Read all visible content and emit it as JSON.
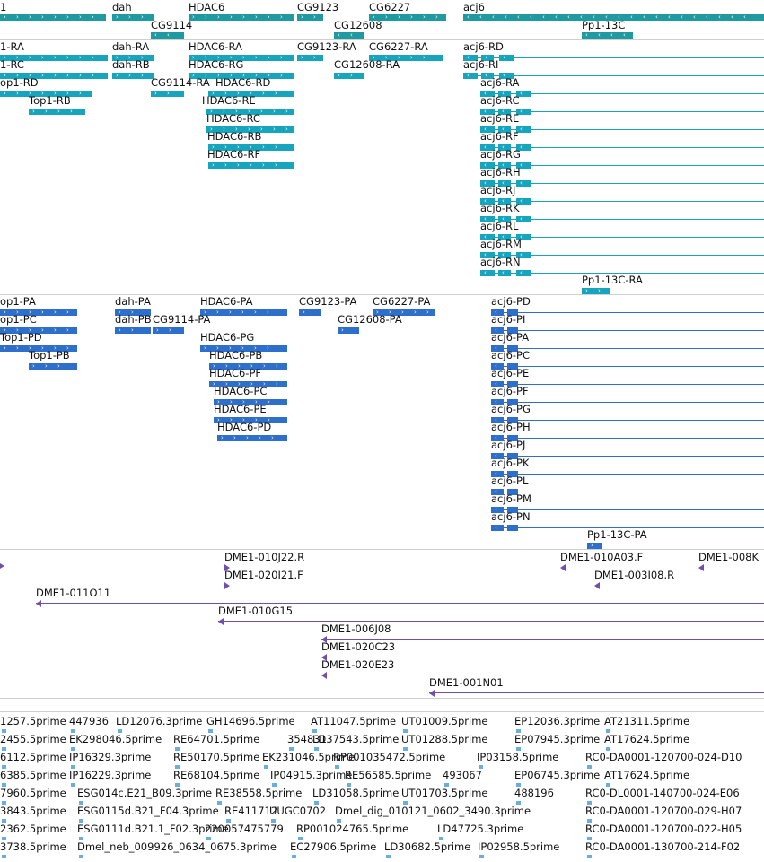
{
  "colors": {
    "gene": "#1e9aa0",
    "gene_dark": "#167a80",
    "mrna": "#17a5bd",
    "protein": "#2e6fcc",
    "clone": "#6f4fb0",
    "est": "#6aaee0",
    "divider": "#cfcfcf"
  },
  "tracks": {
    "genes": {
      "name": "genes",
      "features": [
        {
          "label": "1",
          "strand": "+"
        },
        {
          "label": "dah",
          "strand": "+"
        },
        {
          "label": "HDAC6",
          "strand": "+"
        },
        {
          "label": "CG9123",
          "strand": "+"
        },
        {
          "label": "CG6227",
          "strand": "+"
        },
        {
          "label": "acj6",
          "strand": "-"
        },
        {
          "label": "CG9114",
          "strand": "-"
        },
        {
          "label": "CG12608",
          "strand": "-"
        },
        {
          "label": "Pp1-13C",
          "strand": "-"
        }
      ]
    },
    "transcripts": {
      "name": "transcripts",
      "features": [
        {
          "label": "1-RA"
        },
        {
          "label": "dah-RA"
        },
        {
          "label": "HDAC6-RA"
        },
        {
          "label": "CG9123-RA"
        },
        {
          "label": "CG6227-RA"
        },
        {
          "label": "acj6-RD"
        },
        {
          "label": "1-RC"
        },
        {
          "label": "dah-RB"
        },
        {
          "label": "HDAC6-RG"
        },
        {
          "label": "CG12608-RA"
        },
        {
          "label": "acj6-RI"
        },
        {
          "label": "op1-RD"
        },
        {
          "label": "CG9114-RA"
        },
        {
          "label": "HDAC6-RD"
        },
        {
          "label": "acj6-RA"
        },
        {
          "label": "Top1-RB"
        },
        {
          "label": "HDAC6-RE"
        },
        {
          "label": "acj6-RC"
        },
        {
          "label": "HDAC6-RC"
        },
        {
          "label": "acj6-RE"
        },
        {
          "label": "HDAC6-RB"
        },
        {
          "label": "acj6-RF"
        },
        {
          "label": "HDAC6-RF"
        },
        {
          "label": "acj6-RG"
        },
        {
          "label": "acj6-RH"
        },
        {
          "label": "acj6-RJ"
        },
        {
          "label": "acj6-RK"
        },
        {
          "label": "acj6-RL"
        },
        {
          "label": "acj6-RM"
        },
        {
          "label": "acj6-RN"
        },
        {
          "label": "Pp1-13C-RA"
        }
      ]
    },
    "proteins": {
      "name": "proteins",
      "features": [
        {
          "label": "op1-PA"
        },
        {
          "label": "dah-PA"
        },
        {
          "label": "HDAC6-PA"
        },
        {
          "label": "CG9123-PA"
        },
        {
          "label": "CG6227-PA"
        },
        {
          "label": "acj6-PD"
        },
        {
          "label": "op1-PC"
        },
        {
          "label": "dah-PB"
        },
        {
          "label": "CG9114-PA"
        },
        {
          "label": "CG12608-PA"
        },
        {
          "label": "acj6-PI"
        },
        {
          "label": "Top1-PD"
        },
        {
          "label": "HDAC6-PG"
        },
        {
          "label": "acj6-PA"
        },
        {
          "label": "Top1-PB"
        },
        {
          "label": "HDAC6-PB"
        },
        {
          "label": "acj6-PC"
        },
        {
          "label": "HDAC6-PF"
        },
        {
          "label": "acj6-PE"
        },
        {
          "label": "HDAC6-PC"
        },
        {
          "label": "acj6-PF"
        },
        {
          "label": "HDAC6-PE"
        },
        {
          "label": "acj6-PG"
        },
        {
          "label": "HDAC6-PD"
        },
        {
          "label": "acj6-PH"
        },
        {
          "label": "acj6-PJ"
        },
        {
          "label": "acj6-PK"
        },
        {
          "label": "acj6-PL"
        },
        {
          "label": "acj6-PM"
        },
        {
          "label": "acj6-PN"
        },
        {
          "label": "Pp1-13C-PA"
        }
      ]
    },
    "clones": {
      "name": "clones",
      "features": [
        {
          "label": "DME1-010J22.R"
        },
        {
          "label": "DME1-010A03.F"
        },
        {
          "label": "DME1-008K"
        },
        {
          "label": "DME1-020I21.F"
        },
        {
          "label": "DME1-003I08.R"
        },
        {
          "label": "DME1-011O11"
        },
        {
          "label": "DME1-010G15"
        },
        {
          "label": "DME1-006J08"
        },
        {
          "label": "DME1-020C23"
        },
        {
          "label": "DME1-020E23"
        },
        {
          "label": "DME1-001N01"
        }
      ]
    },
    "ests": {
      "name": "ests",
      "rows": [
        [
          "1257.5prime",
          "447936",
          "LD12076.3prime",
          "GH14696.5prime",
          "AT11047.5prime",
          "UT01009.5prime",
          "EP12036.3prime",
          "AT21311.5prime"
        ],
        [
          "2455.5prime",
          "EK298046.5prime",
          "RE64701.5prime",
          "354831",
          "LD37543.5prime",
          "UT01288.5prime",
          "EP07945.3prime",
          "AT17624.5prime"
        ],
        [
          "6112.5prime",
          "IP16329.3prime",
          "RE50170.5prime",
          "EK231046.5prime",
          "RP001035472.5prime",
          "IP03158.5prime",
          "RC0-DA0001-120700-024-D10"
        ],
        [
          "6385.5prime",
          "IP16229.3prime",
          "RE68104.5prime",
          "IP04915.3prime",
          "RE56585.5prime",
          "493067",
          "EP06745.3prime",
          "AT17624.5prime"
        ],
        [
          "7960.5prime",
          "ESG014c.E21_B09.3prime",
          "RE38558.5prime",
          "LD31058.5prime",
          "UT01703.5prime",
          "488196",
          "RC0-DL0001-140700-024-E06"
        ],
        [
          "3843.5prime",
          "ESG0115d.B21_F04.3prime",
          "RE411712",
          "UUGC0702",
          "Dmel_dig_010121_0602_3490.3prime",
          "RC0-DA0001-120700-029-H07"
        ],
        [
          "2362.5prime",
          "ESG0111d.B21.1_F02.3prime",
          "220057475779",
          "RP001024765.5prime",
          "LD47725.3prime",
          "RC0-DA0001-120700-022-H05"
        ],
        [
          "3738.5prime",
          "Dmel_neb_009926_0634_0675.3prime",
          "EC27906.5prime",
          "LD30682.5prime",
          "IP02958.5prime",
          "RC0-DA0001-130700-214-F02"
        ]
      ]
    }
  }
}
